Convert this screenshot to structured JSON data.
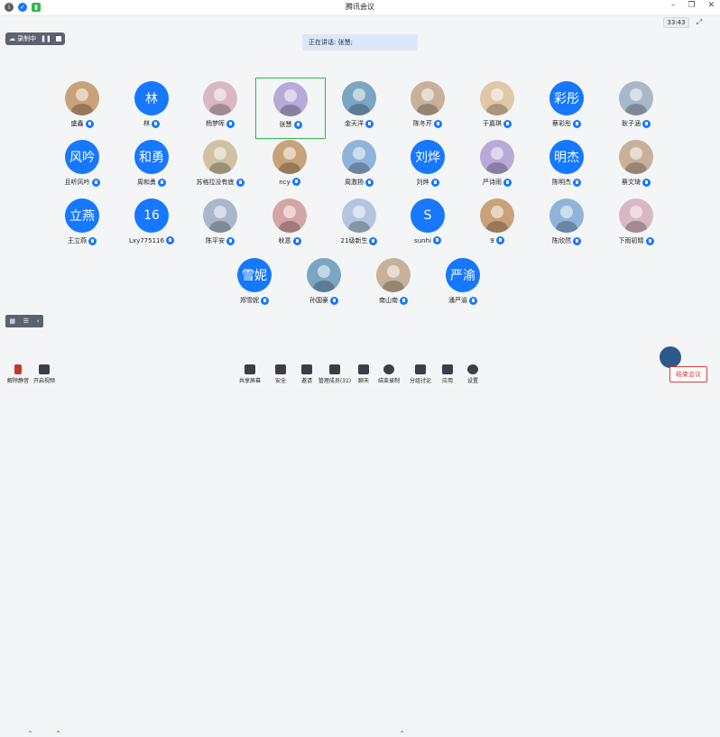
{
  "window": {
    "title": "腾讯会议",
    "clock": "33:43"
  },
  "recording": {
    "label": "录制中"
  },
  "speaking": {
    "label": "正在讲话: 张慧;"
  },
  "participants": [
    {
      "name": "盛鑫",
      "avatar": "photo",
      "initials": ""
    },
    {
      "name": "林",
      "avatar": "blue",
      "initials": "林"
    },
    {
      "name": "杨梦晖",
      "avatar": "photo",
      "initials": ""
    },
    {
      "name": "张慧",
      "avatar": "photo",
      "initials": ""
    },
    {
      "name": "金天洋",
      "avatar": "photo",
      "initials": ""
    },
    {
      "name": "陈冬芹",
      "avatar": "photo",
      "initials": ""
    },
    {
      "name": "于嘉琪",
      "avatar": "photo",
      "initials": ""
    },
    {
      "name": "蔡彩彤",
      "avatar": "blue",
      "initials": "彩彤"
    },
    {
      "name": "耿子涵",
      "avatar": "photo",
      "initials": ""
    },
    {
      "name": "且听风吟",
      "avatar": "blue",
      "initials": "风吟"
    },
    {
      "name": "周和勇",
      "avatar": "blue",
      "initials": "和勇"
    },
    {
      "name": "苏格拉没有底",
      "avatar": "photo",
      "initials": ""
    },
    {
      "name": "ncy",
      "avatar": "photo",
      "initials": ""
    },
    {
      "name": "周激扬",
      "avatar": "photo",
      "initials": ""
    },
    {
      "name": "刘烨",
      "avatar": "blue",
      "initials": "刘烨"
    },
    {
      "name": "严诗雨",
      "avatar": "photo",
      "initials": ""
    },
    {
      "name": "陈明杰",
      "avatar": "blue",
      "initials": "明杰"
    },
    {
      "name": "蔡文琦",
      "avatar": "photo",
      "initials": ""
    },
    {
      "name": "王立燕",
      "avatar": "blue",
      "initials": "立燕"
    },
    {
      "name": "Lxy775116",
      "avatar": "blue",
      "initials": "16"
    },
    {
      "name": "陈平安",
      "avatar": "photo",
      "initials": ""
    },
    {
      "name": "秋意",
      "avatar": "photo",
      "initials": ""
    },
    {
      "name": "21级新生",
      "avatar": "photo",
      "initials": ""
    },
    {
      "name": "sunhi",
      "avatar": "blue",
      "initials": "S"
    },
    {
      "name": "9",
      "avatar": "photo",
      "initials": ""
    },
    {
      "name": "陈欣然",
      "avatar": "photo",
      "initials": ""
    },
    {
      "name": "下雨初晴",
      "avatar": "photo",
      "initials": ""
    },
    {
      "name": "郑雪妮",
      "avatar": "blue",
      "initials": "雪妮"
    },
    {
      "name": "孙国豪",
      "avatar": "photo",
      "initials": ""
    },
    {
      "name": "南山南",
      "avatar": "photo",
      "initials": ""
    },
    {
      "name": "潘严渝",
      "avatar": "blue",
      "initials": "严渝"
    }
  ],
  "toolbar": {
    "unmute": "解除静音",
    "video": "开启视频",
    "share": "共享屏幕",
    "security": "安全",
    "invite": "邀请",
    "members": "管理成员(31)",
    "chat": "聊天",
    "record": "结束录制",
    "breakout": "分组讨论",
    "apps": "应用",
    "settings": "设置",
    "end": "结束会议"
  },
  "colors": {
    "accent": "#1677ff",
    "end": "#e03a3a",
    "selected": "#2db84d"
  }
}
